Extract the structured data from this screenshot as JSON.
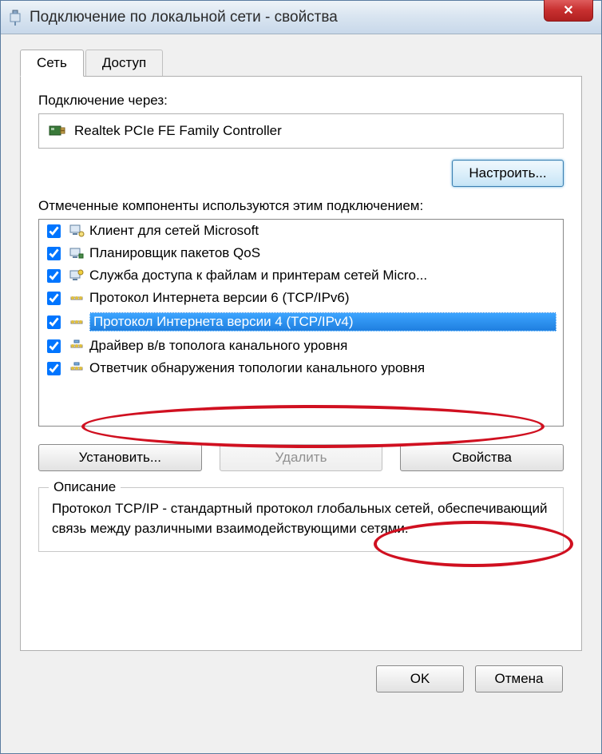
{
  "window": {
    "title": "Подключение по локальной сети - свойства"
  },
  "tabs": {
    "network": "Сеть",
    "access": "Доступ"
  },
  "connect_via_label": "Подключение через:",
  "adapter": "Realtek PCIe FE Family Controller",
  "configure_btn": "Настроить...",
  "components_label": "Отмеченные компоненты используются этим подключением:",
  "components": [
    {
      "checked": true,
      "text": "Клиент для сетей Microsoft",
      "icon": "client"
    },
    {
      "checked": true,
      "text": "Планировщик пакетов QoS",
      "icon": "scheduler"
    },
    {
      "checked": true,
      "text": "Служба доступа к файлам и принтерам сетей Micro...",
      "icon": "fileshare"
    },
    {
      "checked": true,
      "text": "Протокол Интернета версии 6 (TCP/IPv6)",
      "icon": "protocol"
    },
    {
      "checked": true,
      "text": "Протокол Интернета версии 4 (TCP/IPv4)",
      "icon": "protocol",
      "selected": true
    },
    {
      "checked": true,
      "text": "Драйвер в/в тополога канального уровня",
      "icon": "topology"
    },
    {
      "checked": true,
      "text": "Ответчик обнаружения топологии канального уровня",
      "icon": "topology"
    }
  ],
  "buttons": {
    "install": "Установить...",
    "remove": "Удалить",
    "properties": "Свойства",
    "ok": "OK",
    "cancel": "Отмена"
  },
  "description": {
    "legend": "Описание",
    "text": "Протокол TCP/IP - стандартный протокол глобальных сетей, обеспечивающий связь между различными взаимодействующими сетями."
  }
}
